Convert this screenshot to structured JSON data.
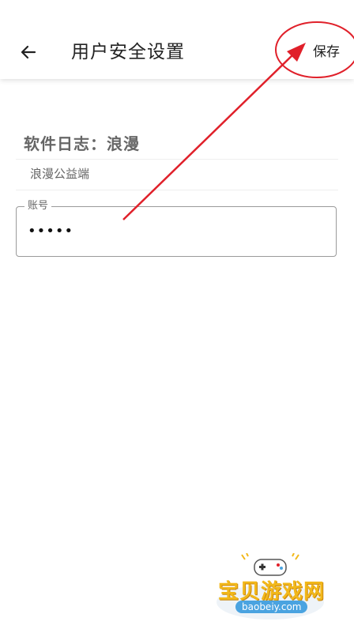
{
  "header": {
    "title": "用户安全设置",
    "save_label": "保存"
  },
  "content": {
    "section_title": "软件日志：浪漫",
    "subtitle": "浪漫公益端",
    "account_field": {
      "label": "账号",
      "value": "•••••"
    }
  },
  "watermark": {
    "brand": "宝贝游戏网",
    "url": "baobeiy.com"
  },
  "colors": {
    "annotation": "#e0202a",
    "watermark_gold": "#f2b81a",
    "watermark_blue": "#4aa3e0"
  },
  "icons": {
    "back": "arrow-left-icon",
    "mascot": "gamepad-icon"
  }
}
